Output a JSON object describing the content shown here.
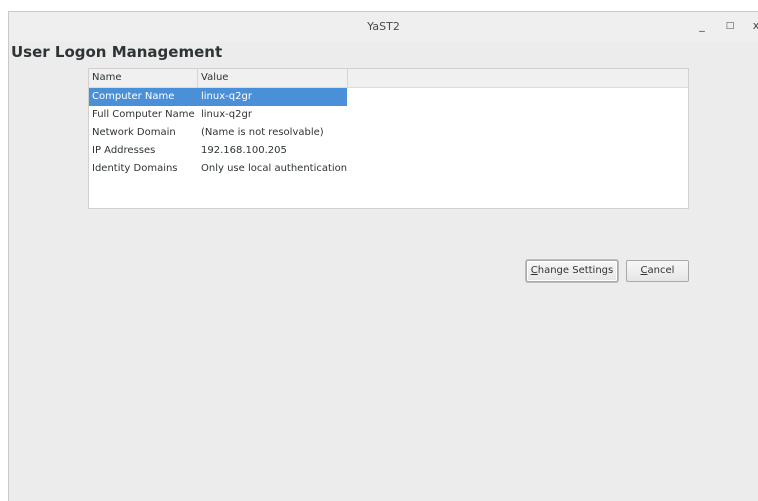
{
  "window": {
    "title": "YaST2",
    "controls": {
      "minimize": "_",
      "maximize": "□",
      "close": "x"
    }
  },
  "page": {
    "heading": "User Logon Management"
  },
  "table": {
    "columns": [
      "Name",
      "Value"
    ],
    "rows": [
      {
        "name": "Computer Name",
        "value": "linux-q2gr",
        "selected": true
      },
      {
        "name": "Full Computer Name",
        "value": "linux-q2gr",
        "selected": false
      },
      {
        "name": "Network Domain",
        "value": "(Name is not resolvable)",
        "selected": false
      },
      {
        "name": "IP Addresses",
        "value": "192.168.100.205",
        "selected": false
      },
      {
        "name": "Identity Domains",
        "value": "Only use local authentication",
        "selected": false
      }
    ]
  },
  "buttons": {
    "change_settings": {
      "mnemonic": "C",
      "rest": "hange Settings"
    },
    "cancel": {
      "mnemonic": "C",
      "rest": "ancel"
    }
  }
}
